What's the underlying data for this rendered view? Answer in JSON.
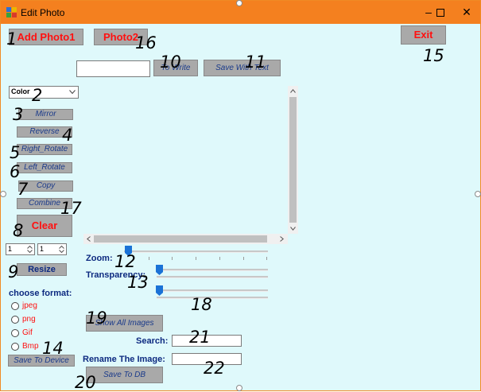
{
  "window": {
    "title": "Edit Photo",
    "minimize": "–",
    "maximize": "☐",
    "close": "✕"
  },
  "buttons": {
    "add_photo1": "Add Photo1",
    "photo2": "Photo2",
    "exit": "Exit",
    "to_write": "To Write",
    "save_with_text": "Save With Text",
    "mirror": "Mirror",
    "reverse": "Reverse",
    "right_rotate": "Right_Rotate",
    "left_rotate": "Left_Rotate",
    "copy": "Copy",
    "combine": "Combine",
    "clear": "Clear",
    "resize": "Resize",
    "save_to_device": "Save To Device",
    "show_all_images": "Show All Images",
    "save_to_db": "Save To DB"
  },
  "color_select": {
    "value": "Color"
  },
  "resize": {
    "width": "1",
    "height": "1"
  },
  "labels": {
    "zoom": "Zoom:",
    "transparency": "Transparency:",
    "choose_format": "choose format:",
    "search": "Search:",
    "rename": "Rename The Image:"
  },
  "formats": [
    "jpeg",
    "png",
    "Gif",
    "Bmp"
  ],
  "annotations": {
    "n1": "1",
    "n2": "2",
    "n3": "3",
    "n4": "4",
    "n5": "5",
    "n6": "6",
    "n7": "7",
    "n8": "8",
    "n9": "9",
    "n10": "10",
    "n11": "11",
    "n12": "12",
    "n13": "13",
    "n14": "14",
    "n15": "15",
    "n16": "16",
    "n17": "17",
    "n18": "18",
    "n19": "19",
    "n20": "20",
    "n21": "21",
    "n22": "22"
  },
  "icons": {
    "app": "app-icon",
    "dropdown": "chevron-down-icon",
    "spinner": "spinner-arrows-icon",
    "scroll_up": "chevron-up-icon",
    "scroll_down": "chevron-down-icon",
    "scroll_left": "chevron-left-icon",
    "scroll_right": "chevron-right-icon"
  },
  "colors": {
    "titlebar": "#f4801f",
    "client": "#dff9fb",
    "button": "#a9a9a9",
    "accent_red": "#ff1010",
    "label_navy": "#0d2a80",
    "slider_thumb": "#1a72d6"
  }
}
